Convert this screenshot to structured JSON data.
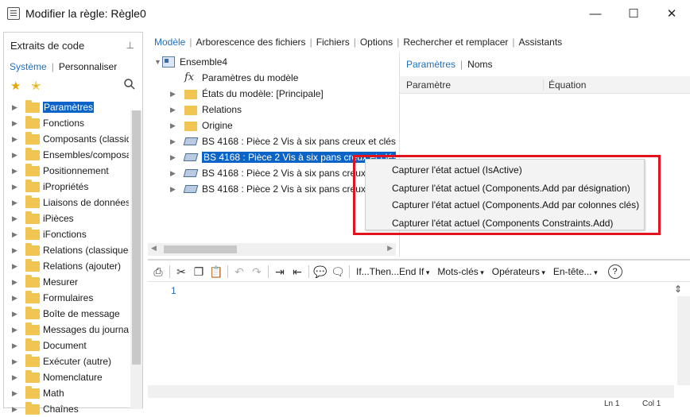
{
  "window": {
    "title": "Modifier la règle: Règle0",
    "buttons": {
      "minimize": "—",
      "maximize": "☐",
      "close": "✕"
    }
  },
  "snippets_panel": {
    "title": "Extraits de code",
    "tabs": [
      "Système",
      "Personnaliser"
    ],
    "items": [
      "Paramètres",
      "Fonctions",
      "Composants (classique)",
      "Ensembles/composants",
      "Positionnement",
      "iPropriétés",
      "Liaisons de données",
      "iPièces",
      "iFonctions",
      "Relations (classique)",
      "Relations (ajouter)",
      "Mesurer",
      "Formulaires",
      "Boîte de message",
      "Messages du journal",
      "Document",
      "Exécuter (autre)",
      "Nomenclature",
      "Math",
      "Chaînes"
    ],
    "selected_index": 0
  },
  "top_menu": [
    "Modèle",
    "Arborescence des fichiers",
    "Fichiers",
    "Options",
    "Rechercher et remplacer",
    "Assistants"
  ],
  "model_tree": {
    "root": "Ensemble4",
    "nodes": [
      {
        "label": "Paramètres du modèle",
        "icon": "fx-icon"
      },
      {
        "label": "États du modèle: [Principale]",
        "icon": "folder-icon"
      },
      {
        "label": "Relations",
        "icon": "folder-icon"
      },
      {
        "label": "Origine",
        "icon": "folder-icon"
      },
      {
        "label": "BS 4168 : Pièce 2 Vis à six pans creux et clés",
        "icon": "part-icon"
      },
      {
        "label": "BS 4168 : Pièce 2 Vis à six pans creux et clés",
        "icon": "part-icon"
      },
      {
        "label": "BS 4168 : Pièce 2 Vis à six pans creux",
        "icon": "part-icon"
      },
      {
        "label": "BS 4168 : Pièce 2 Vis à six pans creux",
        "icon": "part-icon"
      }
    ],
    "selected_index": 5
  },
  "params_panel": {
    "tabs": [
      "Paramètres",
      "Noms"
    ],
    "columns": [
      "Paramètre",
      "Équation"
    ]
  },
  "editor_toolbar": {
    "dropdowns": [
      "If...Then...End If",
      "Mots-clés",
      "Opérateurs",
      "En-tête..."
    ],
    "help": "?"
  },
  "editor": {
    "line_number": "1"
  },
  "status": {
    "line": "Ln 1",
    "col": "Col 1"
  },
  "context_menu": {
    "items": [
      "Capturer l'état actuel (IsActive)",
      "Capturer l'état actuel (Components.Add par désignation)",
      "Capturer l'état actuel (Components.Add par colonnes clés)",
      "Capturer l'état actuel (Components Constraints.Add)"
    ]
  },
  "colors": {
    "accent": "#1f6fbf",
    "selection": "#0a64c8",
    "highlight_box": "#e0131f"
  }
}
